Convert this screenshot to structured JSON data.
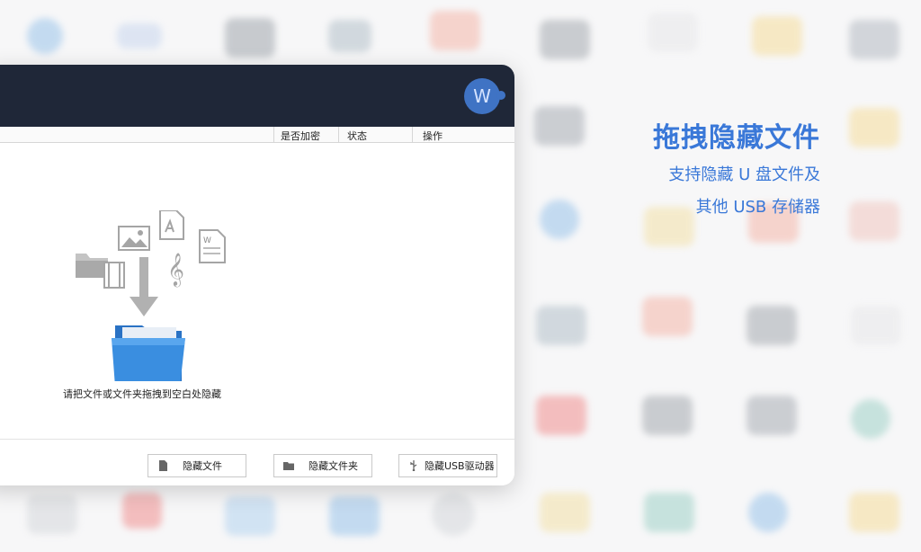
{
  "app": {
    "logo_letter": "W",
    "columns": {
      "encrypted": "是否加密",
      "status": "状态",
      "action": "操作"
    },
    "drop_hint": "请把文件或文件夹拖拽到空白处隐藏",
    "buttons": {
      "hide_file": "隐藏文件",
      "hide_folder": "隐藏文件夹",
      "hide_usb": "隐藏USB驱动器"
    }
  },
  "promo": {
    "title": "拖拽隐藏文件",
    "line1": "支持隐藏 U 盘文件及",
    "line2": "其他 USB 存储器"
  },
  "colors": {
    "titlebar": "#1f2738",
    "accent": "#3a78d8",
    "folder": "#2f86d6"
  }
}
